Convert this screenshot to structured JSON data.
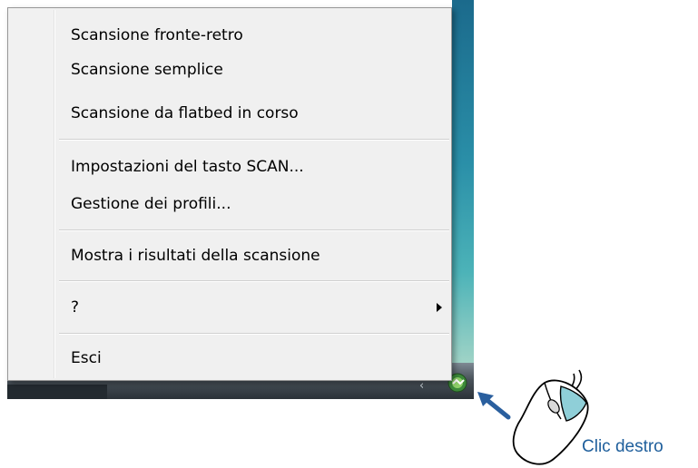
{
  "menu": {
    "items": [
      {
        "label": "Scansione fronte-retro"
      },
      {
        "label": "Scansione semplice"
      },
      {
        "label": "Scansione da flatbed in corso"
      },
      {
        "label": "Impostazioni del tasto SCAN..."
      },
      {
        "label": "Gestione dei profili..."
      },
      {
        "label": "Mostra i risultati della scansione"
      },
      {
        "label": "?",
        "submenu": true
      },
      {
        "label": "Esci"
      }
    ]
  },
  "annotation": {
    "caption": "Clic destro"
  },
  "colors": {
    "caption": "#1f5f9c",
    "arrow": "#2a5f9e",
    "mouse_button": "#8fcfd8"
  },
  "icons": {
    "tray": "scanner-tray-icon",
    "submenu": "chevron-right-icon",
    "pointer": "arrow-icon",
    "mouse": "mouse-icon"
  }
}
